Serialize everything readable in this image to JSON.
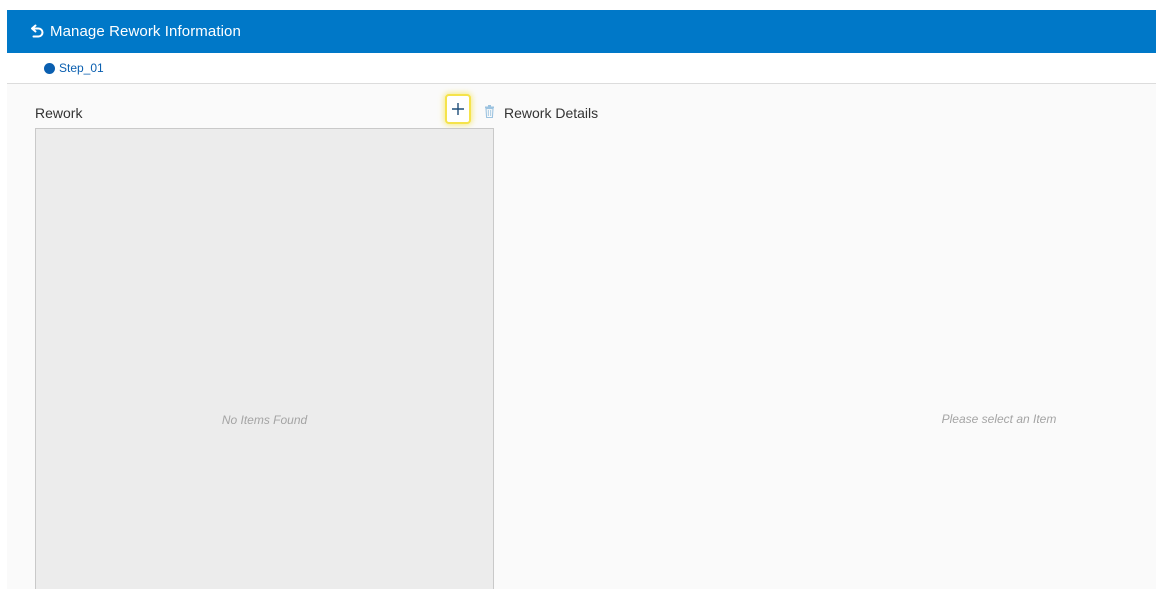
{
  "header": {
    "title": "Manage Rework Information",
    "back_icon": "undo-arrow-icon",
    "color": "#0078c8"
  },
  "steps": [
    {
      "label": "Step_01",
      "color": "#0a5fb0"
    }
  ],
  "rework_panel": {
    "title": "Rework",
    "add_icon": "plus-icon",
    "delete_icon": "trash-icon",
    "empty_text": "No Items Found"
  },
  "details_panel": {
    "title": "Rework Details",
    "empty_text": "Please select an Item"
  },
  "highlight_color": "#f5e34b"
}
